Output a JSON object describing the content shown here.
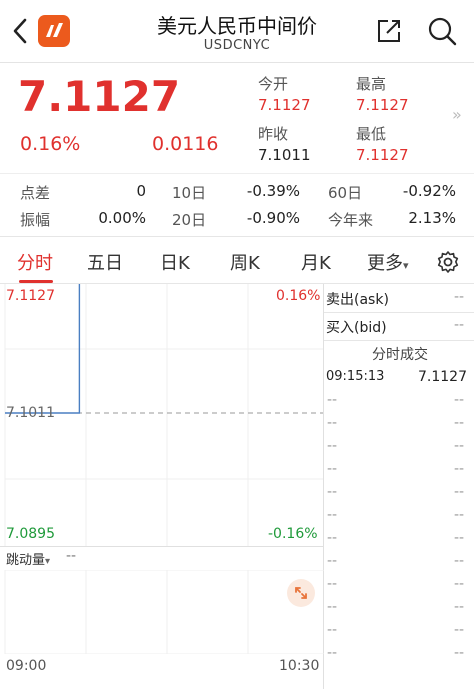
{
  "header": {
    "title": "美元人民币中间价",
    "subtitle": "USDCNYC",
    "back_icon": "chevron-left-icon",
    "share_icon": "share-icon",
    "search_icon": "search-icon",
    "logo": "app-logo"
  },
  "quote": {
    "price": "7.1127",
    "change_pct": "0.16%",
    "change": "0.0116",
    "fields": [
      {
        "label": "今开",
        "value": "7.1127",
        "color": "#e0312e"
      },
      {
        "label": "最高",
        "value": "7.1127",
        "color": "#e0312e"
      },
      {
        "label": "昨收",
        "value": "7.1011",
        "color": "#222222"
      },
      {
        "label": "最低",
        "value": "7.1127",
        "color": "#e0312e"
      }
    ],
    "expand_arrow": "»"
  },
  "stats": [
    {
      "label": "点差",
      "value": "0"
    },
    {
      "label": "10日",
      "value": "-0.39%"
    },
    {
      "label": "60日",
      "value": "-0.92%"
    },
    {
      "label": "振幅",
      "value": "0.00%"
    },
    {
      "label": "20日",
      "value": "-0.90%"
    },
    {
      "label": "今年来",
      "value": "2.13%"
    }
  ],
  "tabs": [
    "分时",
    "五日",
    "日K",
    "周K",
    "月K",
    "更多"
  ],
  "tabs_more_caret": "▾",
  "chart_data": {
    "type": "line",
    "y_labels": {
      "top": "7.1127",
      "mid": "7.1011",
      "bottom": "7.0895"
    },
    "pct_labels": {
      "top": "0.16%",
      "bottom": "-0.16%"
    },
    "ylim": [
      7.0895,
      7.1127
    ],
    "prev_close": 7.1011,
    "x_range_min": [
      0,
      90
    ],
    "points": [
      [
        0,
        7.1011
      ],
      [
        21,
        7.1011
      ],
      [
        21,
        7.1127
      ]
    ],
    "time_labels": {
      "start": "09:00",
      "end": "10:30"
    },
    "colors": {
      "line": "#4a7fc2",
      "up": "#e0312e",
      "down": "#1f9a3a"
    }
  },
  "sub_chart": {
    "label": "跳动量",
    "caret": "▾",
    "value": "--"
  },
  "right_panel": {
    "ask_label": "卖出(ask)",
    "ask_value": "--",
    "bid_label": "买入(bid)",
    "bid_value": "--",
    "trades_title": "分时成交",
    "trade": {
      "time": "09:15:13",
      "price": "7.1127"
    },
    "empty_rows": [
      "--",
      "--",
      "--",
      "--",
      "--",
      "--",
      "--",
      "--",
      "--",
      "--",
      "--",
      "--"
    ]
  }
}
